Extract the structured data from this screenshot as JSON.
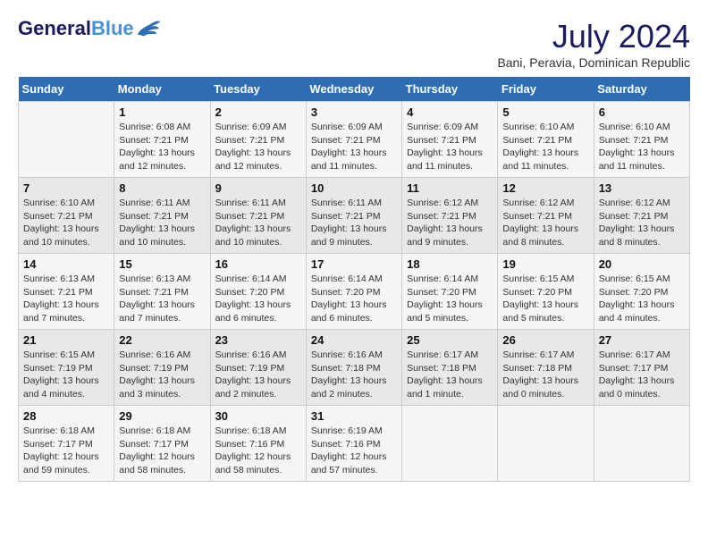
{
  "logo": {
    "line1": "General",
    "line2": "Blue"
  },
  "title": {
    "month_year": "July 2024",
    "location": "Bani, Peravia, Dominican Republic"
  },
  "header_days": [
    "Sunday",
    "Monday",
    "Tuesday",
    "Wednesday",
    "Thursday",
    "Friday",
    "Saturday"
  ],
  "weeks": [
    [
      {
        "day": "",
        "info": ""
      },
      {
        "day": "1",
        "info": "Sunrise: 6:08 AM\nSunset: 7:21 PM\nDaylight: 13 hours\nand 12 minutes."
      },
      {
        "day": "2",
        "info": "Sunrise: 6:09 AM\nSunset: 7:21 PM\nDaylight: 13 hours\nand 12 minutes."
      },
      {
        "day": "3",
        "info": "Sunrise: 6:09 AM\nSunset: 7:21 PM\nDaylight: 13 hours\nand 11 minutes."
      },
      {
        "day": "4",
        "info": "Sunrise: 6:09 AM\nSunset: 7:21 PM\nDaylight: 13 hours\nand 11 minutes."
      },
      {
        "day": "5",
        "info": "Sunrise: 6:10 AM\nSunset: 7:21 PM\nDaylight: 13 hours\nand 11 minutes."
      },
      {
        "day": "6",
        "info": "Sunrise: 6:10 AM\nSunset: 7:21 PM\nDaylight: 13 hours\nand 11 minutes."
      }
    ],
    [
      {
        "day": "7",
        "info": "Sunrise: 6:10 AM\nSunset: 7:21 PM\nDaylight: 13 hours\nand 10 minutes."
      },
      {
        "day": "8",
        "info": "Sunrise: 6:11 AM\nSunset: 7:21 PM\nDaylight: 13 hours\nand 10 minutes."
      },
      {
        "day": "9",
        "info": "Sunrise: 6:11 AM\nSunset: 7:21 PM\nDaylight: 13 hours\nand 10 minutes."
      },
      {
        "day": "10",
        "info": "Sunrise: 6:11 AM\nSunset: 7:21 PM\nDaylight: 13 hours\nand 9 minutes."
      },
      {
        "day": "11",
        "info": "Sunrise: 6:12 AM\nSunset: 7:21 PM\nDaylight: 13 hours\nand 9 minutes."
      },
      {
        "day": "12",
        "info": "Sunrise: 6:12 AM\nSunset: 7:21 PM\nDaylight: 13 hours\nand 8 minutes."
      },
      {
        "day": "13",
        "info": "Sunrise: 6:12 AM\nSunset: 7:21 PM\nDaylight: 13 hours\nand 8 minutes."
      }
    ],
    [
      {
        "day": "14",
        "info": "Sunrise: 6:13 AM\nSunset: 7:21 PM\nDaylight: 13 hours\nand 7 minutes."
      },
      {
        "day": "15",
        "info": "Sunrise: 6:13 AM\nSunset: 7:21 PM\nDaylight: 13 hours\nand 7 minutes."
      },
      {
        "day": "16",
        "info": "Sunrise: 6:14 AM\nSunset: 7:20 PM\nDaylight: 13 hours\nand 6 minutes."
      },
      {
        "day": "17",
        "info": "Sunrise: 6:14 AM\nSunset: 7:20 PM\nDaylight: 13 hours\nand 6 minutes."
      },
      {
        "day": "18",
        "info": "Sunrise: 6:14 AM\nSunset: 7:20 PM\nDaylight: 13 hours\nand 5 minutes."
      },
      {
        "day": "19",
        "info": "Sunrise: 6:15 AM\nSunset: 7:20 PM\nDaylight: 13 hours\nand 5 minutes."
      },
      {
        "day": "20",
        "info": "Sunrise: 6:15 AM\nSunset: 7:20 PM\nDaylight: 13 hours\nand 4 minutes."
      }
    ],
    [
      {
        "day": "21",
        "info": "Sunrise: 6:15 AM\nSunset: 7:19 PM\nDaylight: 13 hours\nand 4 minutes."
      },
      {
        "day": "22",
        "info": "Sunrise: 6:16 AM\nSunset: 7:19 PM\nDaylight: 13 hours\nand 3 minutes."
      },
      {
        "day": "23",
        "info": "Sunrise: 6:16 AM\nSunset: 7:19 PM\nDaylight: 13 hours\nand 2 minutes."
      },
      {
        "day": "24",
        "info": "Sunrise: 6:16 AM\nSunset: 7:18 PM\nDaylight: 13 hours\nand 2 minutes."
      },
      {
        "day": "25",
        "info": "Sunrise: 6:17 AM\nSunset: 7:18 PM\nDaylight: 13 hours\nand 1 minute."
      },
      {
        "day": "26",
        "info": "Sunrise: 6:17 AM\nSunset: 7:18 PM\nDaylight: 13 hours\nand 0 minutes."
      },
      {
        "day": "27",
        "info": "Sunrise: 6:17 AM\nSunset: 7:17 PM\nDaylight: 13 hours\nand 0 minutes."
      }
    ],
    [
      {
        "day": "28",
        "info": "Sunrise: 6:18 AM\nSunset: 7:17 PM\nDaylight: 12 hours\nand 59 minutes."
      },
      {
        "day": "29",
        "info": "Sunrise: 6:18 AM\nSunset: 7:17 PM\nDaylight: 12 hours\nand 58 minutes."
      },
      {
        "day": "30",
        "info": "Sunrise: 6:18 AM\nSunset: 7:16 PM\nDaylight: 12 hours\nand 58 minutes."
      },
      {
        "day": "31",
        "info": "Sunrise: 6:19 AM\nSunset: 7:16 PM\nDaylight: 12 hours\nand 57 minutes."
      },
      {
        "day": "",
        "info": ""
      },
      {
        "day": "",
        "info": ""
      },
      {
        "day": "",
        "info": ""
      }
    ]
  ]
}
